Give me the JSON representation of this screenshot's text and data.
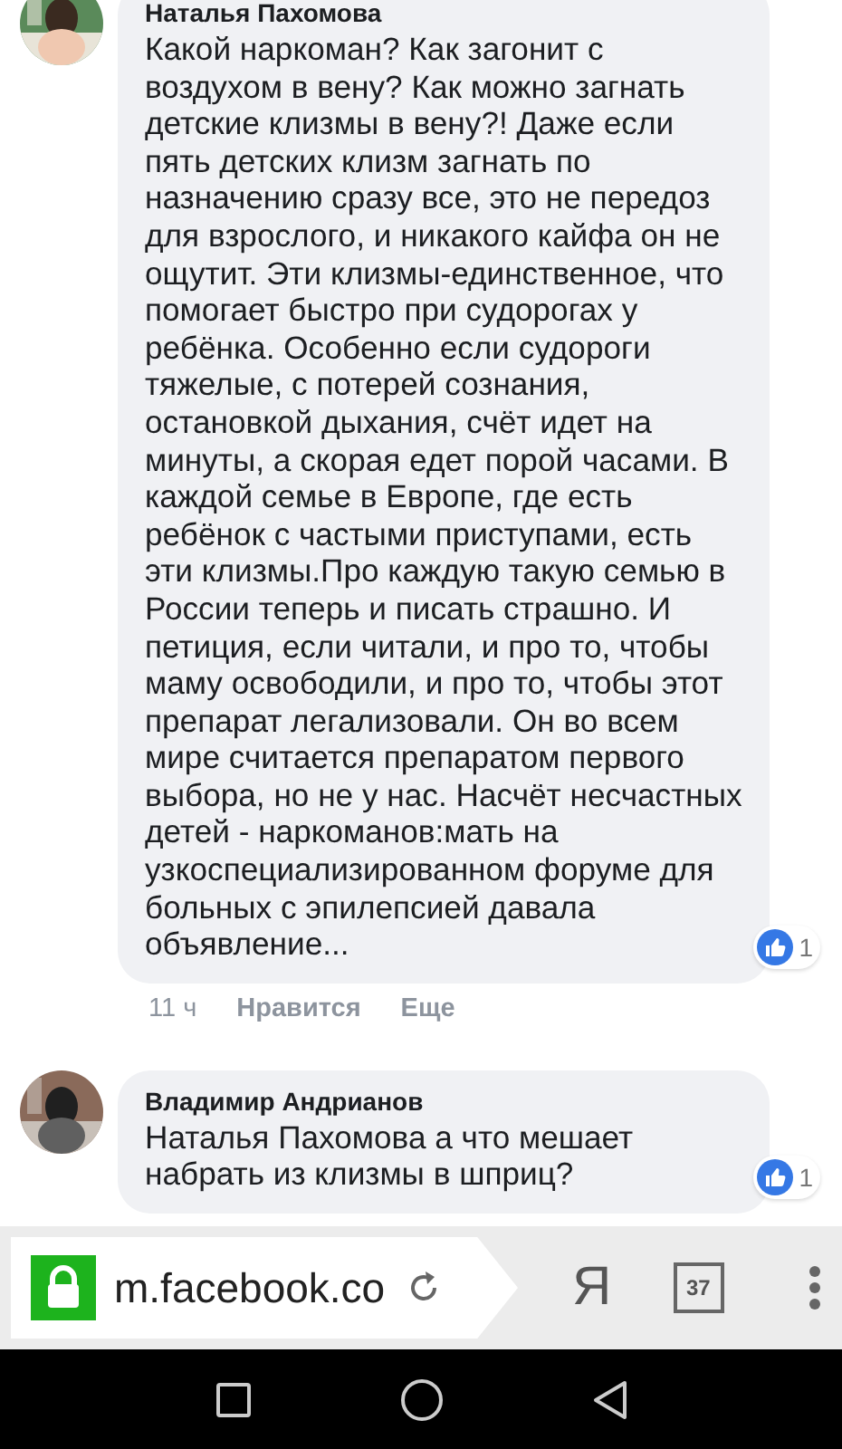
{
  "comments": [
    {
      "author": "Наталья Пахомова",
      "text": "Какой наркоман? Как загонит с воздухом в вену? Как можно загнать детские клизмы в вену?! Даже если пять детских клизм загнать по назначению сразу все, это не передоз для взрослого, и никакого кайфа он не ощутит. Эти клизмы-единственное, что помогает быстро при судорогах у ребёнка. Особенно если судороги тяжелые, с потерей сознания, остановкой дыхания, счёт идет на минуты, а скорая едет порой часами. В каждой семье в Европе, где есть ребёнок с частыми приступами, есть эти клизмы.Про каждую такую семью в России теперь и писать страшно. И петиция, если читали, и про то, чтобы маму освободили, и про то, чтобы этот препарат легализовали. Он во всем мире считается препаратом первого выбора, но не у нас. Насчёт несчастных детей - наркоманов:мать на узкоспециализированном форуме для больных с эпилепсией давала объявление...",
      "likes": "1",
      "actions": {
        "time": "11 ч",
        "like": "Нравится",
        "more": "Еще"
      }
    },
    {
      "author": "Владимир Андрианов",
      "text": "Наталья Пахомова а что мешает набрать из клизмы в шприц?",
      "likes": "1"
    }
  ],
  "browser": {
    "url": "m.facebook.co",
    "secure": true,
    "search_key": "Я",
    "tabs_count": "37"
  }
}
